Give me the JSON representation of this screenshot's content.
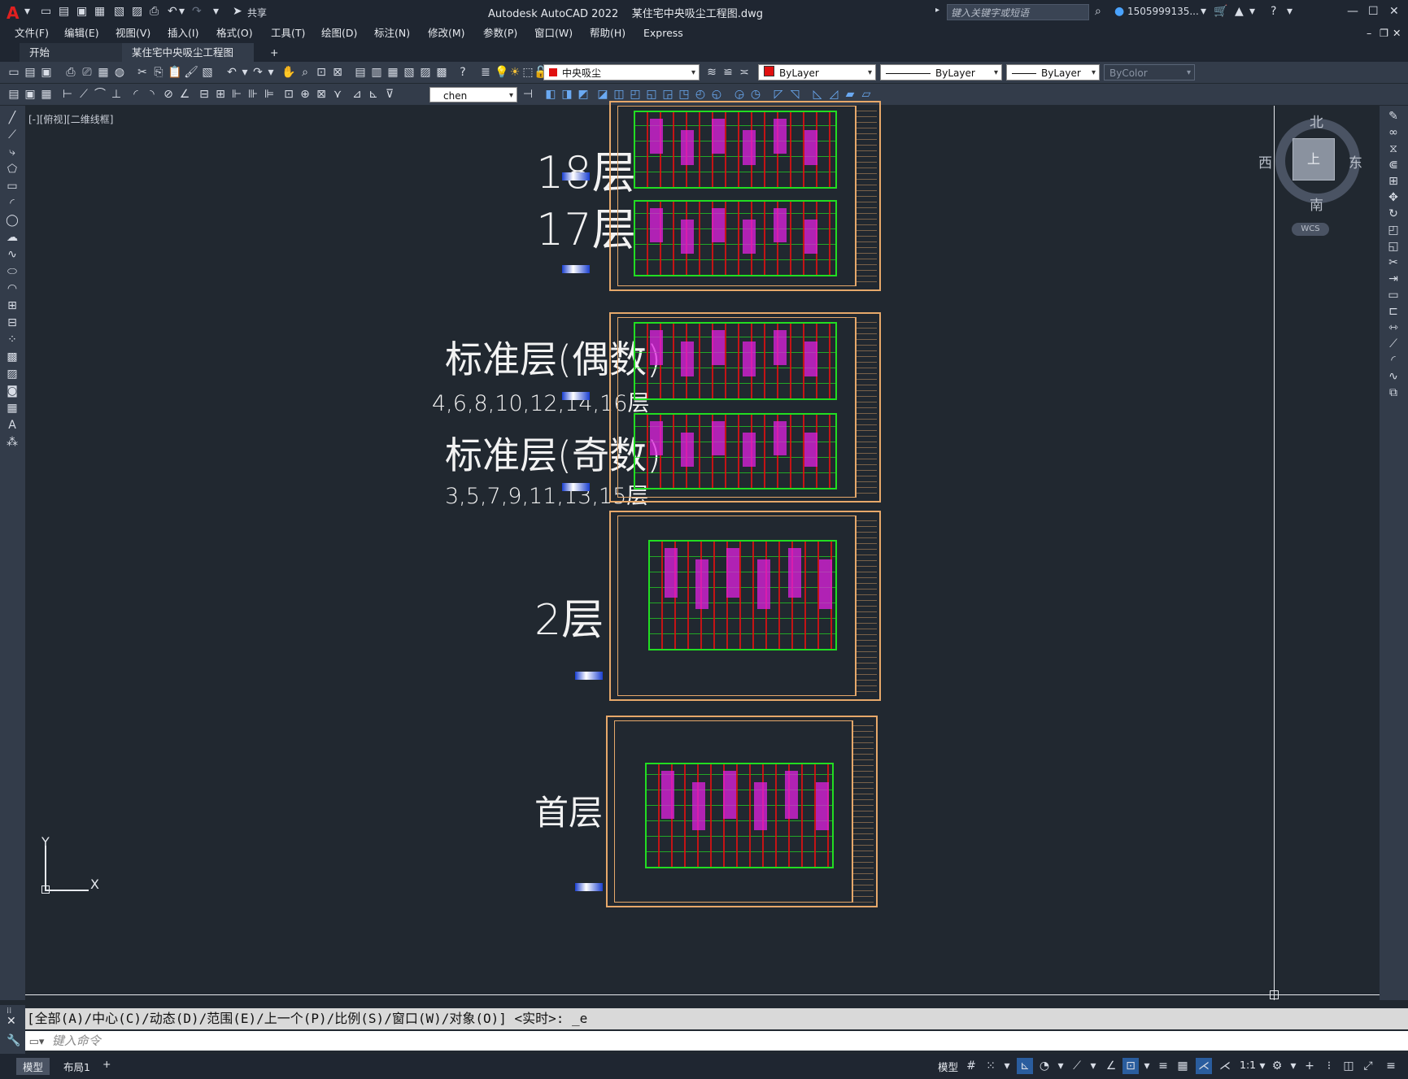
{
  "app": {
    "title": "Autodesk AutoCAD 2022",
    "file": "某住宅中央吸尘工程图.dwg",
    "search_placeholder": "键入关键字或短语",
    "user": "1505999135...",
    "share": "共享"
  },
  "menu": [
    "文件(F)",
    "编辑(E)",
    "视图(V)",
    "插入(I)",
    "格式(O)",
    "工具(T)",
    "绘图(D)",
    "标注(N)",
    "修改(M)",
    "参数(P)",
    "窗口(W)",
    "帮助(H)",
    "Express"
  ],
  "tabs": {
    "start": "开始",
    "active": "某住宅中央吸尘工程图*",
    "add": "+"
  },
  "toolbar": {
    "layer": "中央吸尘",
    "color": "ByLayer",
    "linetype": "ByLayer",
    "lineweight": "ByLayer",
    "plotstyle": "ByColor",
    "textstyle": "chen",
    "layer_color": "#e01010"
  },
  "viewport": {
    "label": "[-][俯视][二维线框]"
  },
  "viewcube": {
    "north": "北",
    "south": "南",
    "east": "东",
    "west": "西",
    "top": "上",
    "wcs": "WCS"
  },
  "floors": {
    "f18": "18层",
    "f17": "17层",
    "std_even": "标准层(偶数)",
    "std_even_list": "4,6,8,10,12,14,16层",
    "std_odd": "标准层(奇数)",
    "std_odd_list": "3,5,7,9,11,13,15层",
    "f2": "2层",
    "f1": "首层"
  },
  "ucs": {
    "x": "X",
    "y": "Y"
  },
  "command": {
    "history": "[全部(A)/中心(C)/动态(D)/范围(E)/上一个(P)/比例(S)/窗口(W)/对象(O)] <实时>: _e",
    "placeholder": "键入命令"
  },
  "layout_tabs": [
    "模型",
    "布局1",
    "+"
  ],
  "status": {
    "mode": "模型",
    "scale": "1:1"
  },
  "colors": {
    "accent": "#e6a86a",
    "bg": "#212830",
    "panel": "#333c4a",
    "green": "#22dd22",
    "red": "#e01010",
    "magenta": "#e020e0"
  }
}
